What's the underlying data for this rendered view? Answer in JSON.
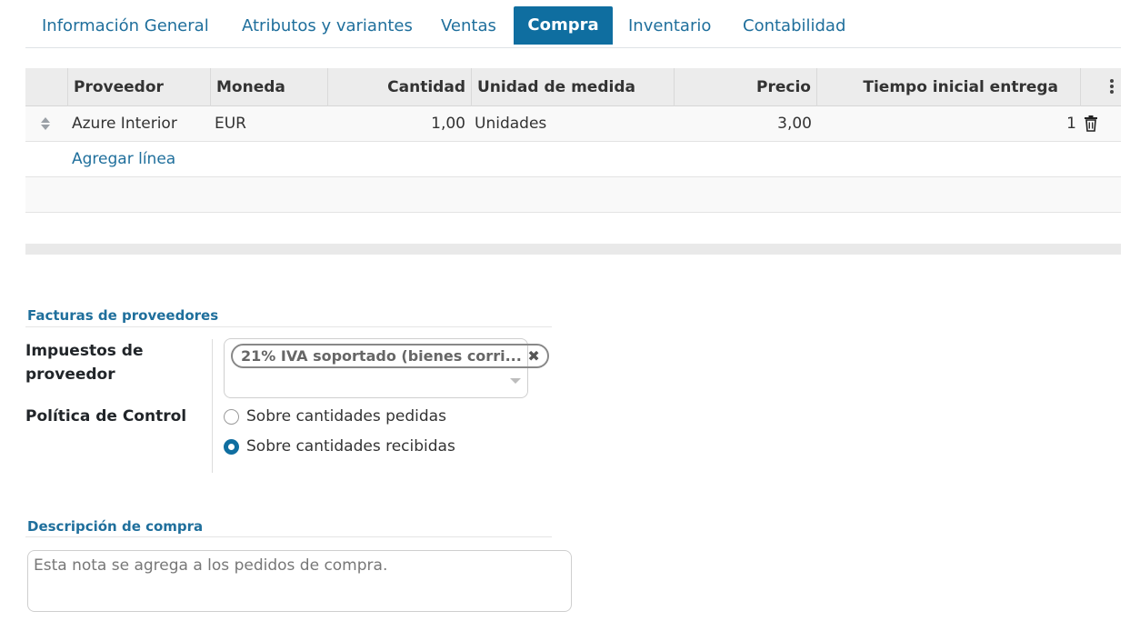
{
  "tabs": [
    {
      "label": "Información General"
    },
    {
      "label": "Atributos y variantes"
    },
    {
      "label": "Ventas"
    },
    {
      "label": "Compra"
    },
    {
      "label": "Inventario"
    },
    {
      "label": "Contabilidad"
    }
  ],
  "active_tab": "Compra",
  "vendors_table": {
    "columns": [
      "Proveedor",
      "Moneda",
      "Cantidad",
      "Unidad de medida",
      "Precio",
      "Tiempo inicial entrega"
    ],
    "rows": [
      {
        "proveedor": "Azure Interior",
        "moneda": "EUR",
        "cantidad": "1,00",
        "unidad": "Unidades",
        "precio": "3,00",
        "tiempo": "1"
      }
    ],
    "add_line_label": "Agregar línea"
  },
  "vendor_bills": {
    "title": "Facturas de proveedores",
    "taxes_label": "Impuestos de proveedor",
    "taxes": [
      {
        "label": "21% IVA soportado (bienes corri..."
      }
    ],
    "control_policy_label": "Política de Control",
    "control_policy_options": [
      {
        "label": "Sobre cantidades pedidas",
        "checked": false
      },
      {
        "label": "Sobre cantidades recibidas",
        "checked": true
      }
    ]
  },
  "purchase_description": {
    "title": "Descripción de compra",
    "placeholder": "Esta nota se agrega a los pedidos de compra."
  },
  "colors": {
    "accent": "#0f6ea0",
    "link": "#1f6f9c"
  }
}
